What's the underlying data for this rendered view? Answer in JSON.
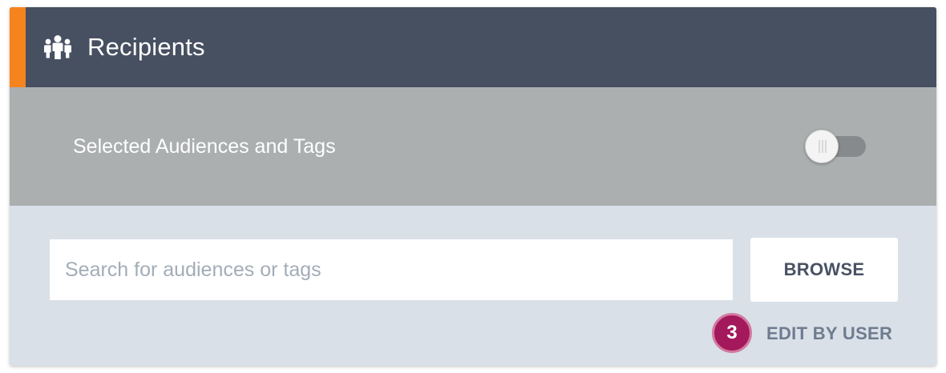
{
  "header": {
    "title": "Recipients",
    "icon": "people-group-icon",
    "accent_color": "#f5841f",
    "background_color": "#475061"
  },
  "audience_toggle": {
    "label": "Selected Audiences and Tags",
    "state": "off"
  },
  "search": {
    "value": "",
    "placeholder": "Search for audiences or tags"
  },
  "browse": {
    "label": "BROWSE"
  },
  "edit_by_user": {
    "badge_count": "3",
    "badge_color": "#a3195b",
    "label": "EDIT BY USER"
  }
}
